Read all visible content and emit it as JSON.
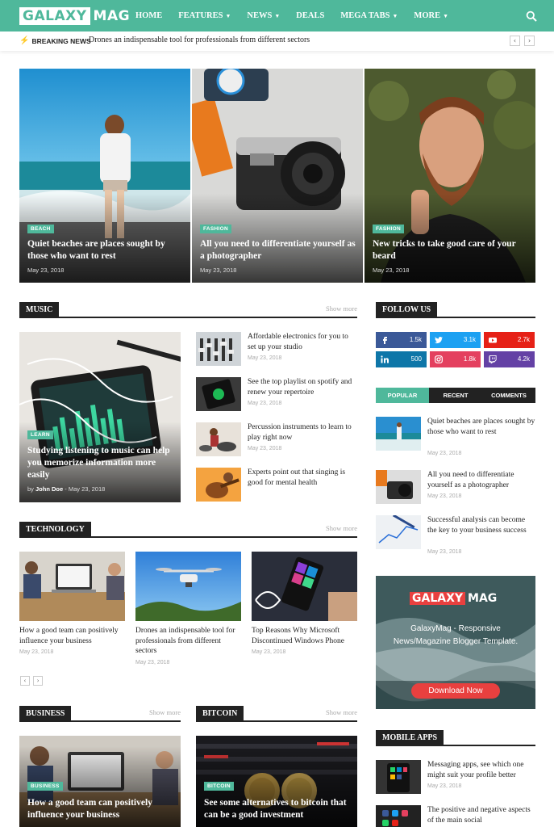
{
  "header": {
    "logo_part1": "GALAXY",
    "logo_part2": "MAG",
    "nav": [
      {
        "label": "HOME",
        "dropdown": false
      },
      {
        "label": "FEATURES",
        "dropdown": true
      },
      {
        "label": "NEWS",
        "dropdown": true
      },
      {
        "label": "DEALS",
        "dropdown": false
      },
      {
        "label": "MEGA TABS",
        "dropdown": true
      },
      {
        "label": "MORE",
        "dropdown": true
      }
    ],
    "dropdown_glyph": "▼",
    "search_icon": "search-icon"
  },
  "breaking": {
    "label": "BREAKING NEWS",
    "text": "Drones an indispensable tool for professionals from different sectors",
    "prev": "‹",
    "next": "›"
  },
  "hero": [
    {
      "tag": "BEACH",
      "title": "Quiet beaches are places sought by those who want to rest",
      "date": "May 23, 2018"
    },
    {
      "tag": "FASHION",
      "title": "All you need to differentiate yourself as a photographer",
      "date": "May 23, 2018"
    },
    {
      "tag": "FASHION",
      "title": "New tricks to take good care of your beard",
      "date": "May 23, 2018"
    }
  ],
  "music": {
    "title": "MUSIC",
    "show_more": "Show more",
    "featured": {
      "tag": "LEARN",
      "title": "Studying listening to music can help you memorize information more easily",
      "by": "by",
      "author": "John Doe",
      "date": "May 23, 2018"
    },
    "items": [
      {
        "title": "Affordable electronics for you to set up your studio",
        "date": "May 23, 2018"
      },
      {
        "title": "See the top playlist on spotify and renew your repertoire",
        "date": "May 23, 2018"
      },
      {
        "title": "Percussion instruments to learn to play right now",
        "date": "May 23, 2018"
      },
      {
        "title": "Experts point out that singing is good for mental health",
        "date": "May 23, 2018"
      }
    ]
  },
  "technology": {
    "title": "TECHNOLOGY",
    "show_more": "Show more",
    "items": [
      {
        "title": "How a good team can positively influence your business",
        "date": "May 23, 2018"
      },
      {
        "title": "Drones an indispensable tool for professionals from different sectors",
        "date": "May 23, 2018"
      },
      {
        "title": "Top Reasons Why Microsoft Discontinued Windows Phone",
        "date": "May 23, 2018"
      }
    ],
    "prev": "‹",
    "next": "›"
  },
  "business": {
    "title": "BUSINESS",
    "show_more": "Show more",
    "featured": {
      "tag": "BUSINESS",
      "title": "How a good team can positively influence your business"
    }
  },
  "bitcoin": {
    "title": "BITCOIN",
    "show_more": "Show more",
    "featured": {
      "tag": "BITCOIN",
      "title": "See some alternatives to bitcoin that can be a good investment"
    }
  },
  "follow": {
    "title": "FOLLOW US",
    "networks": [
      {
        "name": "facebook",
        "icon": "facebook-icon",
        "count": "1.5k",
        "color": "#3b5998"
      },
      {
        "name": "twitter",
        "icon": "twitter-icon",
        "count": "3.1k",
        "color": "#1da1f2"
      },
      {
        "name": "youtube",
        "icon": "youtube-icon",
        "count": "2.7k",
        "color": "#e62117"
      },
      {
        "name": "linkedin",
        "icon": "linkedin-icon",
        "count": "500",
        "color": "#0e76a8"
      },
      {
        "name": "instagram",
        "icon": "instagram-icon",
        "count": "1.8k",
        "color": "#e4405f"
      },
      {
        "name": "twitch",
        "icon": "twitch-icon",
        "count": "4.2k",
        "color": "#6441a5"
      }
    ]
  },
  "popular_tabs": {
    "tabs": [
      "POPULAR",
      "RECENT",
      "COMMENTS"
    ],
    "active": 0,
    "items": [
      {
        "title": "Quiet beaches are places sought by those who want to rest",
        "date": "May 23, 2018"
      },
      {
        "title": "All you need to differentiate yourself as a photographer",
        "date": "May 23, 2018"
      },
      {
        "title": "Successful analysis can become the key to your business success",
        "date": "May 23, 2018"
      }
    ]
  },
  "ad": {
    "logo_part1": "GALAXY",
    "logo_part2": "MAG",
    "line1": "GalaxyMag - Responsive",
    "line2": "News/Magazine Blogger Template.",
    "button": "Download Now"
  },
  "mobile_apps": {
    "title": "MOBILE APPS",
    "items": [
      {
        "title": "Messaging apps, see which one might suit your profile better",
        "date": "May 23, 2018"
      },
      {
        "title": "The positive and negative aspects of the main social",
        "date": ""
      }
    ]
  },
  "colors": {
    "accent": "#4fb89b",
    "dark": "#222222",
    "ad_button": "#e8403f"
  }
}
